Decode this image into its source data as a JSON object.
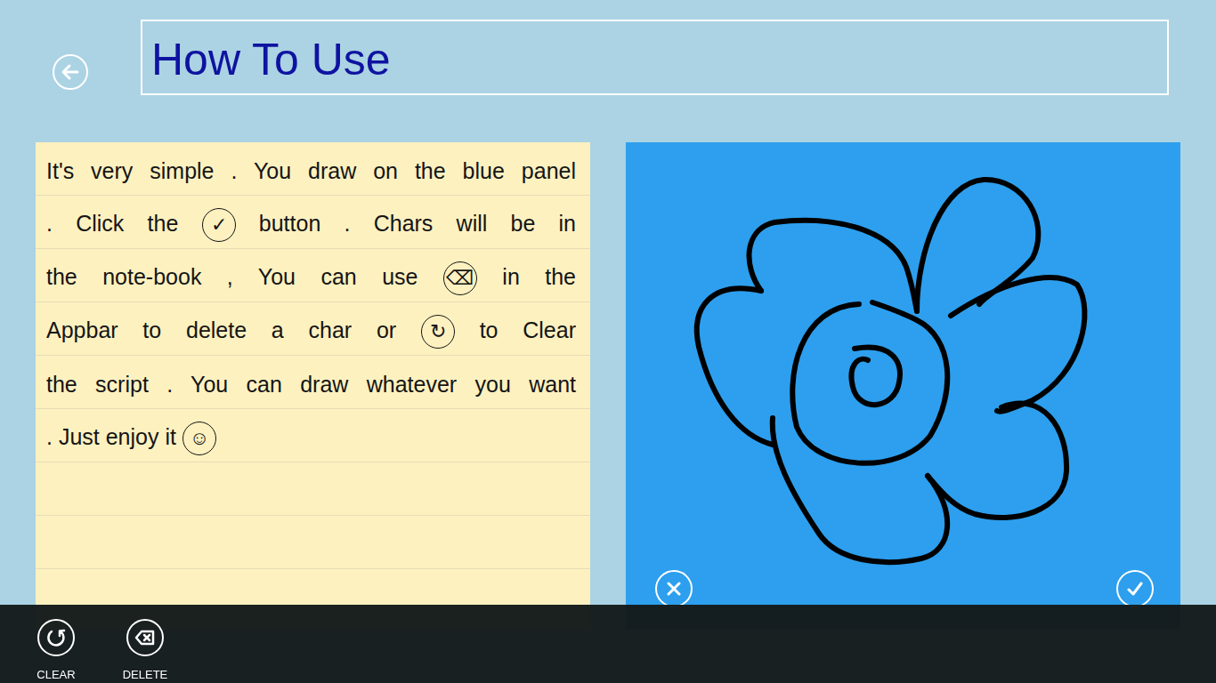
{
  "title": "How To Use",
  "notebook": {
    "lines": [
      [
        {
          "kind": "text",
          "text": "It's very simple . You draw on the blue panel"
        }
      ],
      [
        {
          "kind": "text",
          "text": ". Click the"
        },
        {
          "kind": "icon",
          "text": "✓"
        },
        {
          "kind": "text",
          "text": "button . Chars will be in"
        }
      ],
      [
        {
          "kind": "text",
          "text": "the note-book , You can use"
        },
        {
          "kind": "icon",
          "text": "⌫"
        },
        {
          "kind": "text",
          "text": "in the"
        }
      ],
      [
        {
          "kind": "text",
          "text": "Appbar to delete a char or"
        },
        {
          "kind": "icon",
          "text": "↻"
        },
        {
          "kind": "text",
          "text": "to Clear"
        }
      ],
      [
        {
          "kind": "text",
          "text": "the script . You can draw whatever you want"
        }
      ],
      [
        {
          "kind": "text",
          "text": ". Just enjoy it"
        },
        {
          "kind": "icon",
          "text": "☺"
        }
      ]
    ]
  },
  "appbar": {
    "buttons": [
      {
        "label": "CLEAR"
      },
      {
        "label": "DELETE"
      }
    ]
  }
}
